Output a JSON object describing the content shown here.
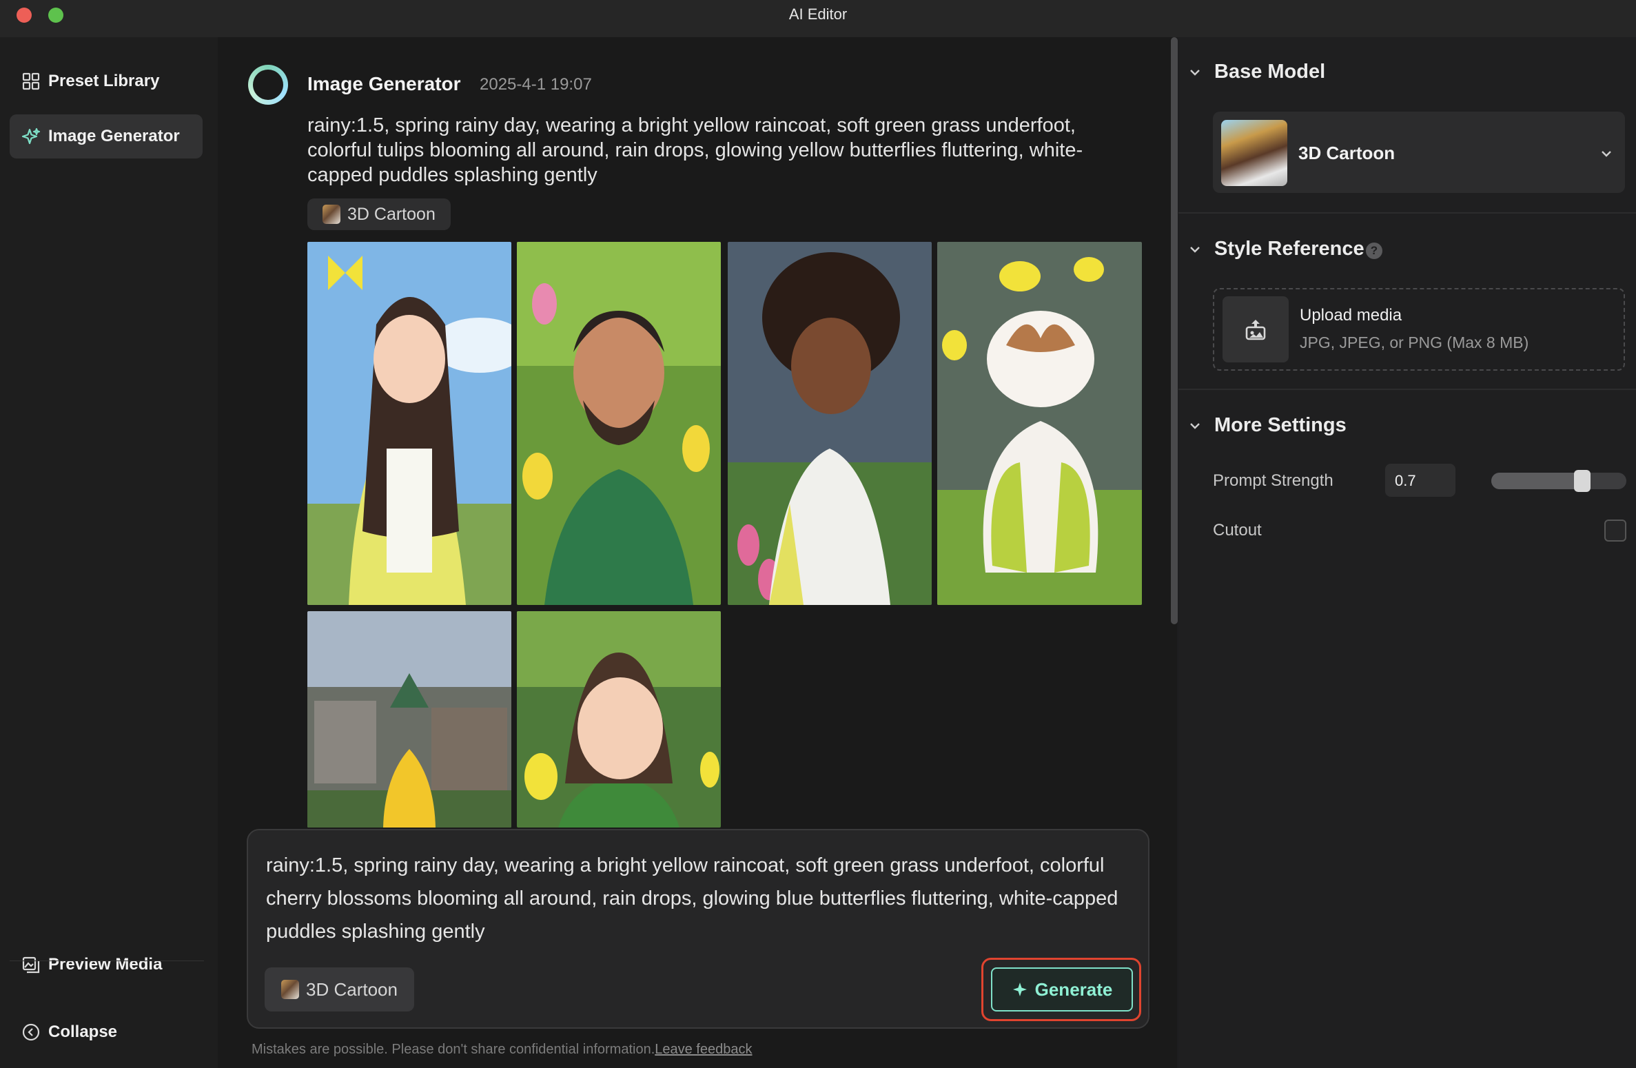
{
  "window": {
    "title": "AI Editor"
  },
  "sidebar": {
    "items": [
      {
        "label": "Preset Library",
        "icon": "grid-icon",
        "active": false
      },
      {
        "label": "Image Generator",
        "icon": "sparkle-icon",
        "active": true
      }
    ],
    "preview_media": "Preview Media",
    "collapse": "Collapse"
  },
  "generation": {
    "title": "Image Generator",
    "timestamp": "2025-4-1 19:07",
    "prompt": "rainy:1.5, spring rainy day, wearing a bright yellow raincoat, soft green grass underfoot, colorful tulips blooming all around, rain drops, glowing yellow butterflies fluttering, white-capped puddles splashing gently",
    "model_chip": "3D Cartoon",
    "images_count": 6
  },
  "composer": {
    "text": "rainy:1.5, spring rainy day, wearing a bright yellow raincoat, soft green grass underfoot, colorful cherry blossoms blooming all around, rain drops, glowing blue butterflies fluttering, white-capped puddles splashing gently",
    "model_chip": "3D Cartoon",
    "generate_label": "Generate"
  },
  "disclaimer": {
    "text": "Mistakes are possible. Please don't share confidential information.",
    "link": "Leave feedback"
  },
  "panel": {
    "base_model": {
      "title": "Base Model",
      "selected": "3D Cartoon"
    },
    "style_reference": {
      "title": "Style Reference",
      "help": "?",
      "upload_title": "Upload media",
      "upload_hint": "JPG, JPEG, or PNG (Max 8 MB)"
    },
    "more_settings": {
      "title": "More Settings",
      "prompt_strength_label": "Prompt Strength",
      "prompt_strength_value": "0.7",
      "prompt_strength_fraction": 0.7,
      "cutout_label": "Cutout",
      "cutout_checked": false
    }
  },
  "colors": {
    "accent": "#8ff0d4",
    "highlight_ring": "#e0442f"
  }
}
